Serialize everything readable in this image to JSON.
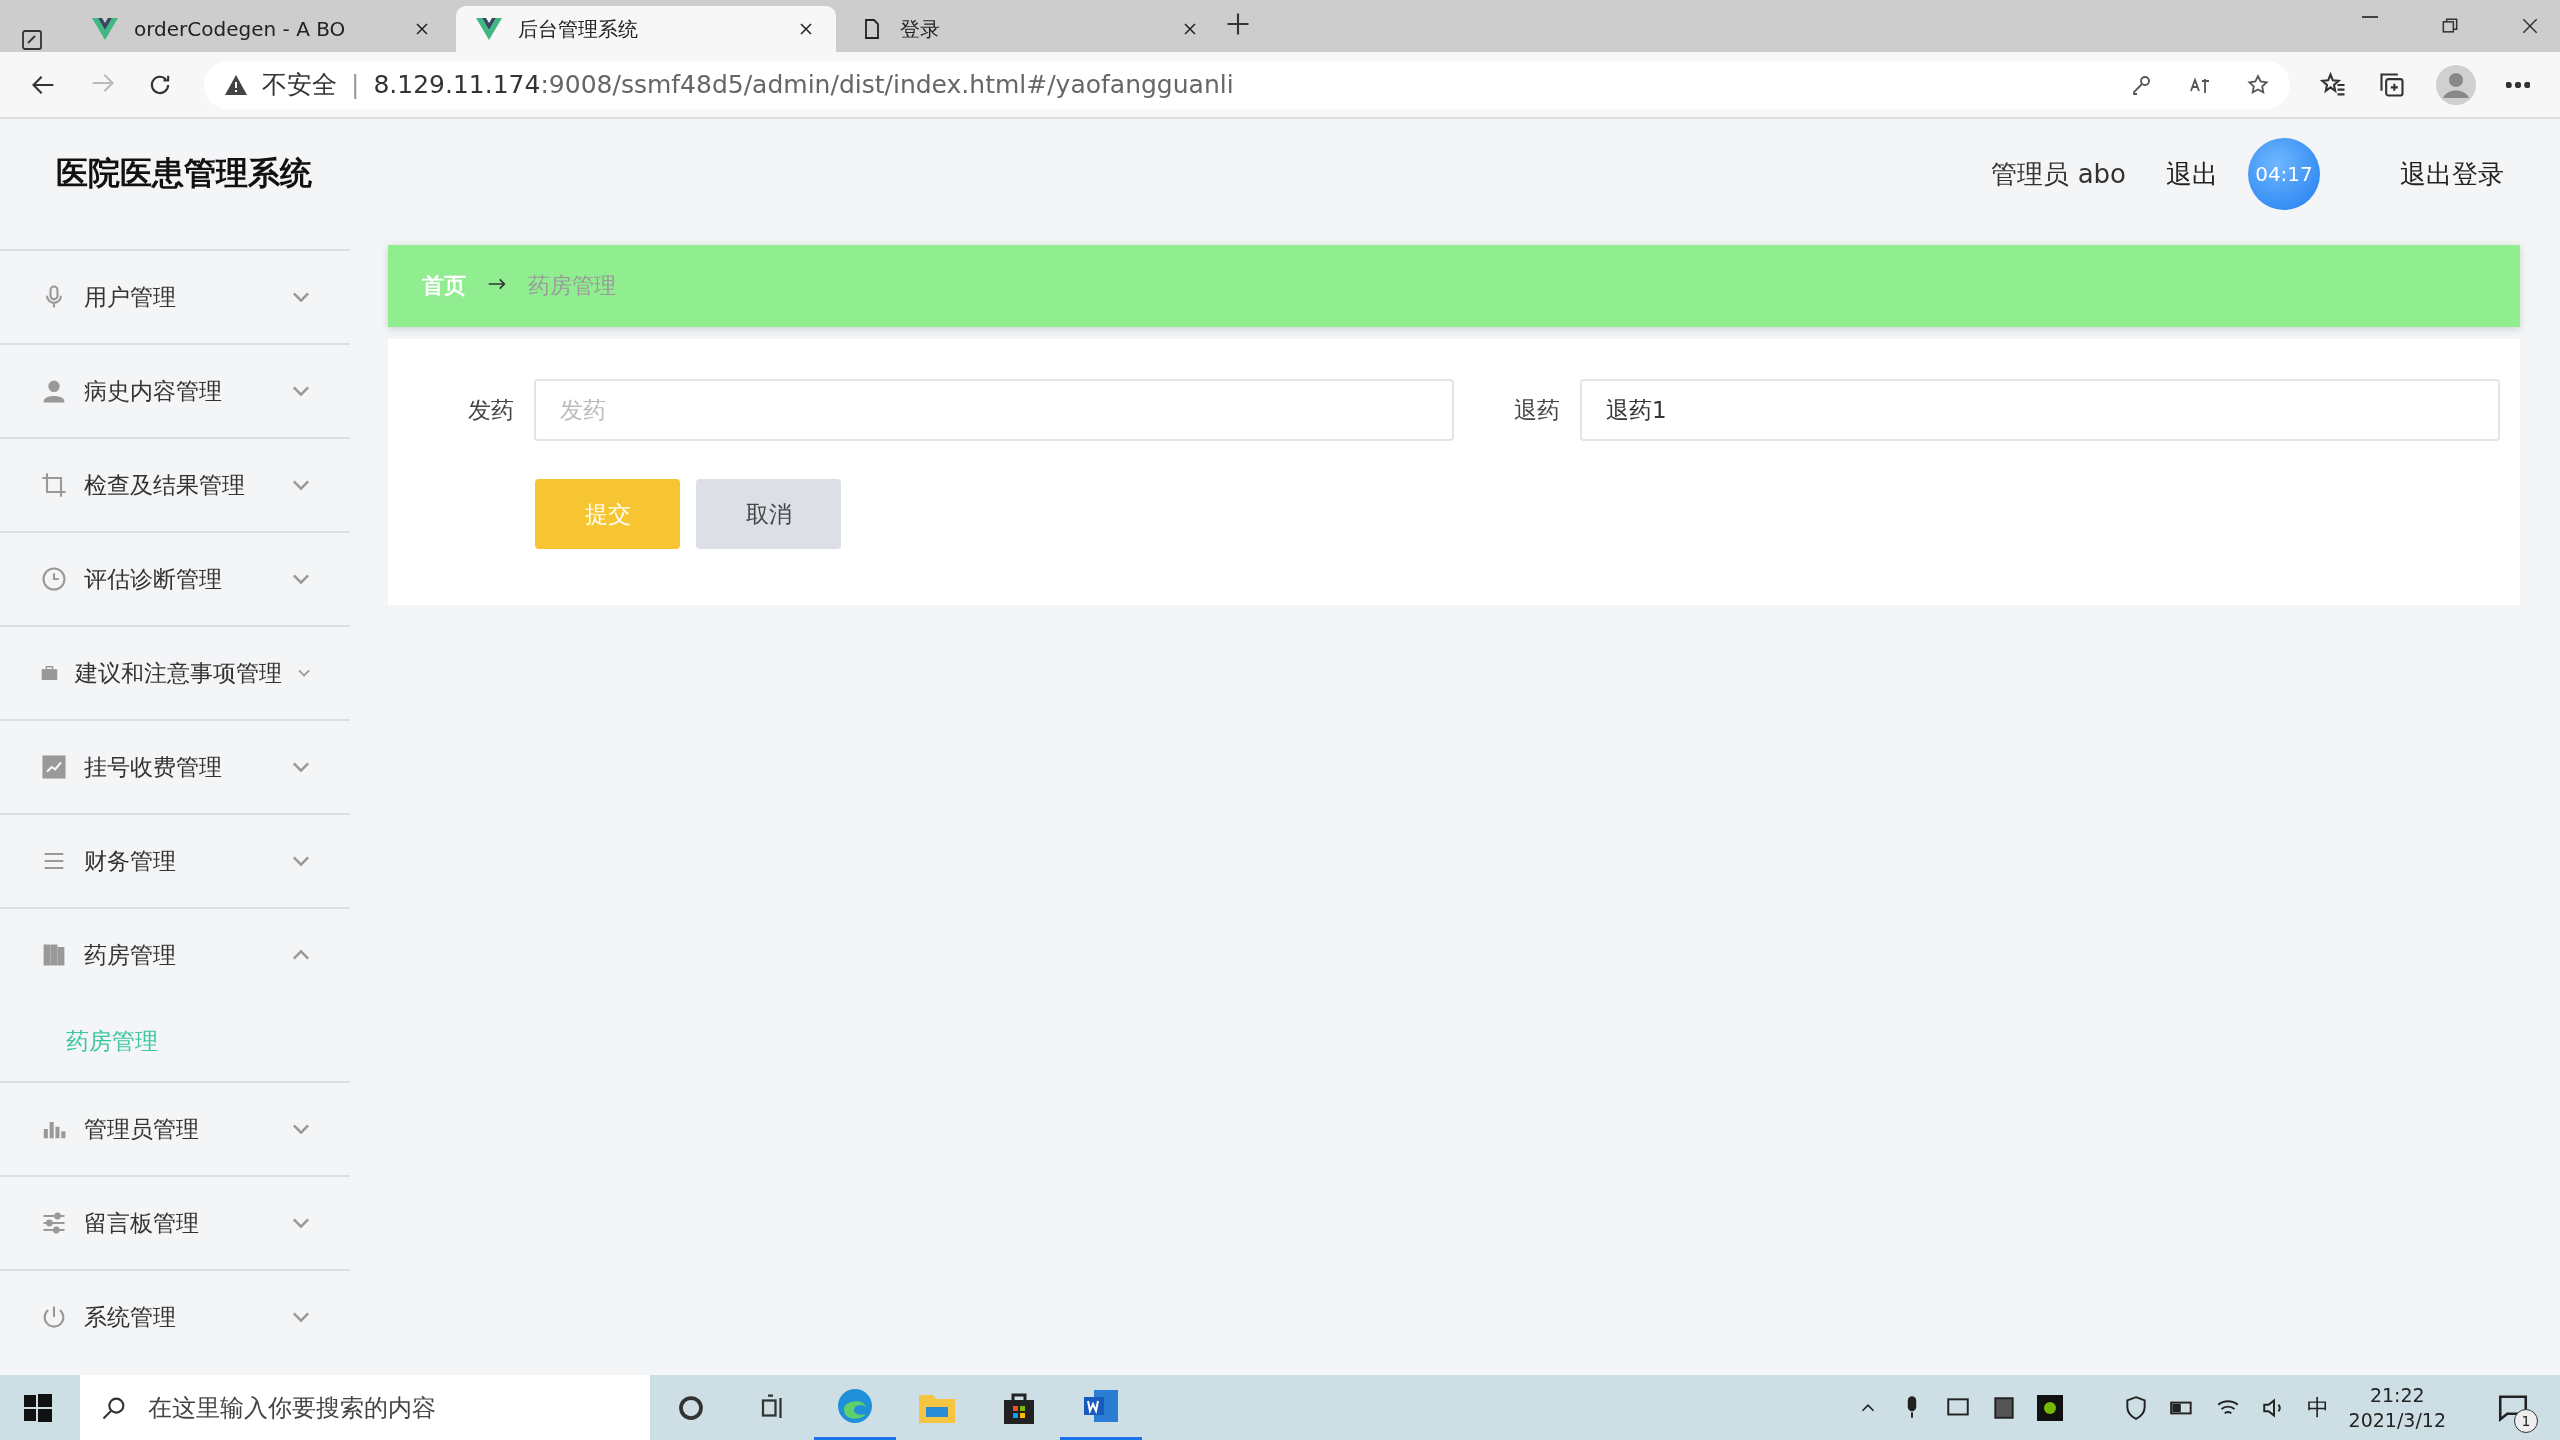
{
  "browser": {
    "tabs": [
      {
        "title": "orderCodegen - A BO",
        "selected": false,
        "kind": "vue"
      },
      {
        "title": "后台管理系统",
        "selected": true,
        "kind": "vue"
      },
      {
        "title": "登录",
        "selected": false,
        "kind": "page"
      }
    ],
    "security": "不安全",
    "separator": "|",
    "url_host": "8.129.11.174",
    "url_rest": ":9008/ssmf48d5/admin/dist/index.html#/yaofangguanli"
  },
  "header": {
    "title": "医院医患管理系统",
    "user": "管理员 abo",
    "links": [
      "退出",
      "退出登录"
    ],
    "timer": "04:17"
  },
  "sidebar": {
    "items": [
      {
        "label": "用户管理",
        "expanded": false
      },
      {
        "label": "病史内容管理",
        "expanded": false
      },
      {
        "label": "检查及结果管理",
        "expanded": false
      },
      {
        "label": "评估诊断管理",
        "expanded": false
      },
      {
        "label": "建议和注意事项管理",
        "expanded": false
      },
      {
        "label": "挂号收费管理",
        "expanded": false
      },
      {
        "label": "财务管理",
        "expanded": false
      },
      {
        "label": "药房管理",
        "expanded": true,
        "children": [
          {
            "label": "药房管理",
            "selected": true
          }
        ]
      },
      {
        "label": "管理员管理",
        "expanded": false
      },
      {
        "label": "留言板管理",
        "expanded": false
      },
      {
        "label": "系统管理",
        "expanded": false
      }
    ]
  },
  "breadcrumb": [
    "首页",
    "药房管理"
  ],
  "form": {
    "fields": [
      {
        "label": "发药",
        "placeholder": "发药"
      },
      {
        "label": "退药",
        "value": "退药1"
      }
    ],
    "buttons": [
      {
        "label": "提交",
        "kind": "primary"
      },
      {
        "label": "取消",
        "kind": "secondary"
      }
    ]
  },
  "taskbar": {
    "search_placeholder": "在这里输入你要搜索的内容",
    "ime": "中",
    "time": "21:22",
    "date": "2021/3/12",
    "notifications": "1"
  }
}
